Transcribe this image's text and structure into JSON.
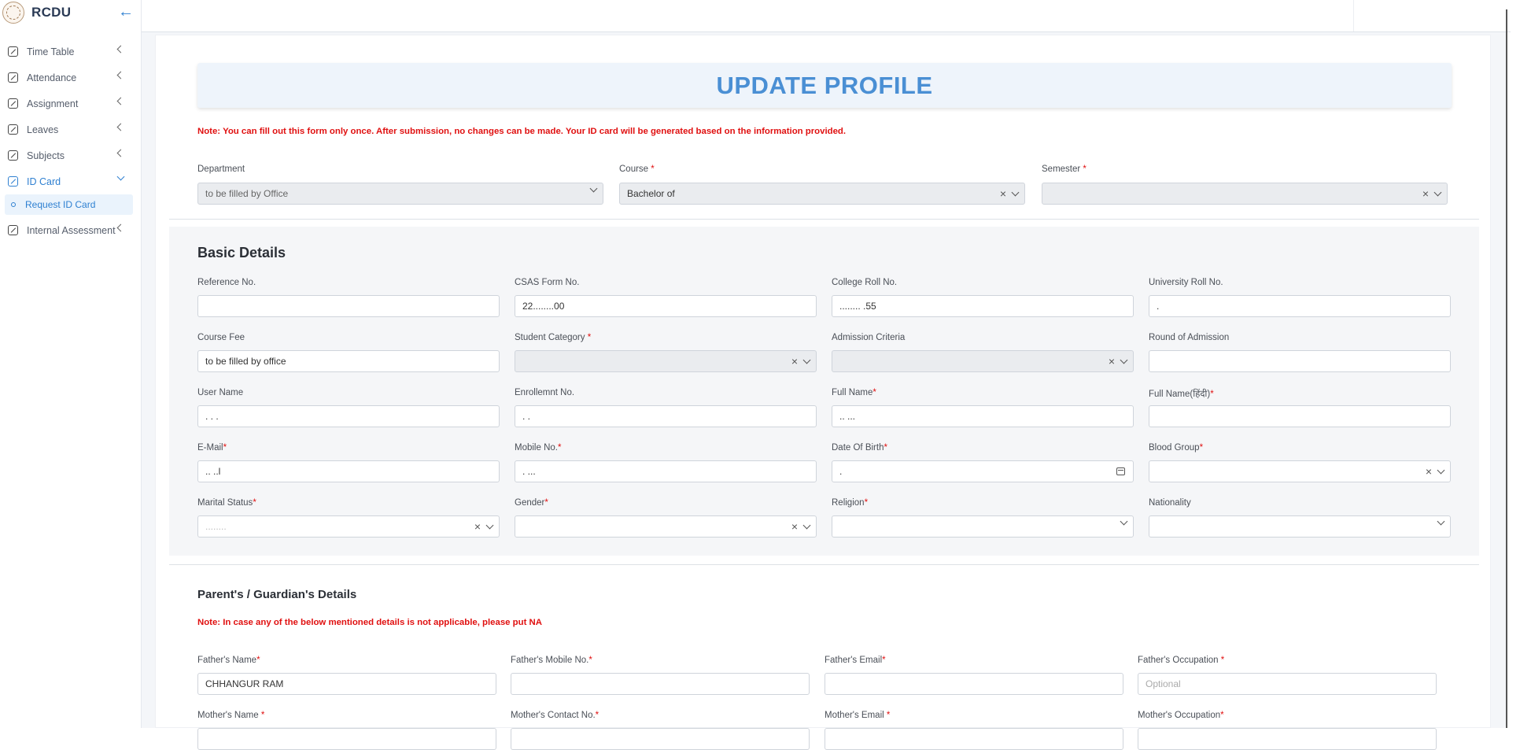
{
  "sidebar": {
    "brand": "RCDU",
    "items": [
      {
        "label": "Time Table"
      },
      {
        "label": "Attendance"
      },
      {
        "label": "Assignment"
      },
      {
        "label": "Leaves"
      },
      {
        "label": "Subjects"
      },
      {
        "label": "ID Card"
      },
      {
        "label": "Internal Assessment"
      }
    ],
    "sub_items": [
      {
        "label": "Request ID Card"
      }
    ]
  },
  "page": {
    "title": "UPDATE PROFILE",
    "note_top": "Note: You can fill out this form only once. After submission, no changes can be made. Your ID card will be generated based on the information provided.",
    "department": {
      "label": "Department",
      "value": "to be filled by Office"
    },
    "course": {
      "label": "Course",
      "value": "Bachelor of"
    },
    "semester": {
      "label": "Semester",
      "value": ""
    },
    "basic": {
      "title": "Basic Details",
      "reference_no": {
        "label": "Reference No.",
        "value": ""
      },
      "csas_form_no": {
        "label": "CSAS Form No.",
        "value": "22........00"
      },
      "college_roll": {
        "label": "College Roll No.",
        "value": "........ .55"
      },
      "university_roll": {
        "label": "University Roll No.",
        "value": "."
      },
      "course_fee": {
        "label": "Course Fee",
        "value": "to be filled by office"
      },
      "student_category": {
        "label": "Student Category",
        "value": ""
      },
      "admission_criteria": {
        "label": "Admission Criteria",
        "value": ""
      },
      "round_of_admission": {
        "label": "Round of Admission",
        "value": ""
      },
      "user_name": {
        "label": "User Name",
        "value": ".          . ."
      },
      "enrollment_no": {
        "label": "Enrollemnt No.",
        "value": ".         ."
      },
      "full_name": {
        "label": "Full Name",
        "value": "..           ..."
      },
      "full_name_hindi": {
        "label": "Full Name(हिंदी)",
        "value": ""
      },
      "email": {
        "label": "E-Mail",
        "value": "..            ..l"
      },
      "mobile": {
        "label": "Mobile No.",
        "value": "   .    ..."
      },
      "dob": {
        "label": "Date Of Birth",
        "value": "."
      },
      "blood_group": {
        "label": "Blood Group",
        "value": ""
      },
      "marital_status": {
        "label": "Marital Status",
        "value": "........"
      },
      "gender": {
        "label": "Gender",
        "value": ""
      },
      "religion": {
        "label": "Religion",
        "value": ""
      },
      "nationality": {
        "label": "Nationality",
        "value": ""
      }
    },
    "parents": {
      "title": "Parent's / Guardian's Details",
      "note": "Note: In case any of the below mentioned details is not applicable, please put NA",
      "father_name": {
        "label": "Father's Name",
        "value": "CHHANGUR RAM"
      },
      "father_mobile": {
        "label": "Father's Mobile No.",
        "value": ""
      },
      "father_email": {
        "label": "Father's Email",
        "value": ""
      },
      "father_occupation": {
        "label": "Father's Occupation ",
        "placeholder": "Optional"
      },
      "mother_name": {
        "label": "Mother's Name ",
        "value": ""
      },
      "mother_contact": {
        "label": "Mother's Contact No.",
        "value": ""
      },
      "mother_email": {
        "label": "Mother's Email ",
        "value": ""
      },
      "mother_occupation": {
        "label": "Mother's Occupation",
        "value": ""
      }
    },
    "required_mark": "*"
  },
  "colors": {
    "accent": "#2f80d1",
    "title": "#4a8fd4",
    "warning": "#e01010"
  }
}
